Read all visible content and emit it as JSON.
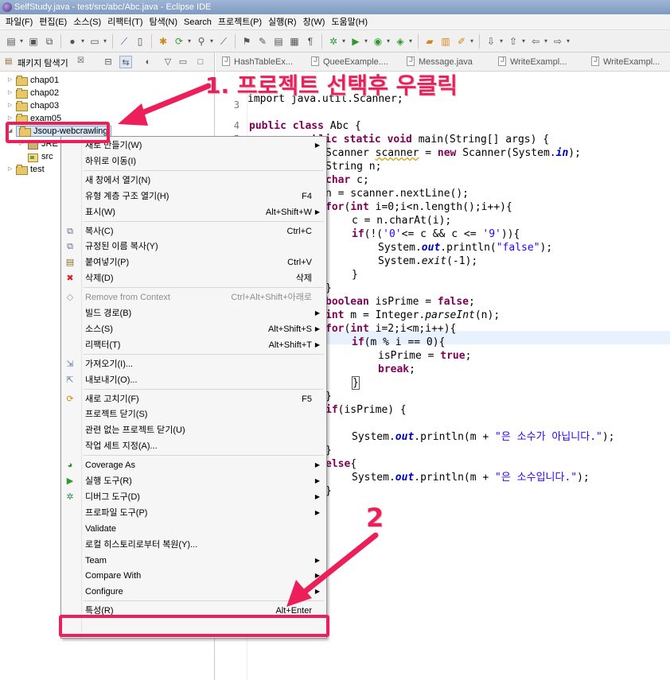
{
  "window": {
    "title": "SelfStudy.java - test/src/abc/Abc.java - Eclipse IDE"
  },
  "menubar": [
    "파일(F)",
    "편집(E)",
    "소스(S)",
    "리팩터(T)",
    "탐색(N)",
    "Search",
    "프로젝트(P)",
    "실행(R)",
    "창(W)",
    "도움말(H)"
  ],
  "package_explorer": {
    "title": "패키지 탐색기",
    "close": "☒",
    "items": [
      {
        "label": "chap01"
      },
      {
        "label": "chap02"
      },
      {
        "label": "chap03"
      },
      {
        "label": "exam05"
      },
      {
        "label": "Jsoup-webcrawling"
      },
      {
        "label": "JRE"
      },
      {
        "label": "src"
      },
      {
        "label": "test"
      }
    ]
  },
  "editor_tabs": [
    {
      "label": "HashTableEx..."
    },
    {
      "label": "QueeExample...."
    },
    {
      "label": "Message.java"
    },
    {
      "label": "WriteExampl..."
    },
    {
      "label": "WriteExampl..."
    }
  ],
  "code": {
    "line_numbers": [
      "3",
      "4",
      "5"
    ],
    "lines": [
      {
        "segments": [
          {
            "t": "import java.util.Scanner;",
            "c": ""
          }
        ]
      },
      {
        "segments": [
          {
            "t": "public class",
            "c": "kw"
          },
          {
            "t": " Abc {",
            "c": ""
          }
        ]
      },
      {
        "segments": [
          {
            "t": "public static void",
            "c": "kw"
          },
          {
            "t": " main(String[] args) {",
            "c": ""
          }
        ]
      },
      {
        "segments": [
          {
            "t": "Scanner ",
            "c": ""
          },
          {
            "t": "scanner",
            "c": "warn"
          },
          {
            "t": " = ",
            "c": ""
          },
          {
            "t": "new",
            "c": "kw"
          },
          {
            "t": " Scanner(System.",
            "c": ""
          },
          {
            "t": "in",
            "c": "fld"
          },
          {
            "t": ");",
            "c": ""
          }
        ]
      },
      {
        "segments": [
          {
            "t": "String n;",
            "c": ""
          }
        ]
      },
      {
        "segments": [
          {
            "t": "char",
            "c": "kw"
          },
          {
            "t": " c;",
            "c": ""
          }
        ]
      },
      {
        "segments": [
          {
            "t": "n = scanner.nextLine();",
            "c": ""
          }
        ]
      },
      {
        "segments": [
          {
            "t": "for",
            "c": "kw"
          },
          {
            "t": "(",
            "c": ""
          },
          {
            "t": "int",
            "c": "kw"
          },
          {
            "t": " i=0;i<n.length();i++){",
            "c": ""
          }
        ]
      },
      {
        "segments": [
          {
            "t": "c = n.charAt(i);",
            "c": ""
          }
        ]
      },
      {
        "segments": [
          {
            "t": "if",
            "c": "kw"
          },
          {
            "t": "(!(",
            "c": ""
          },
          {
            "t": "'0'",
            "c": "str"
          },
          {
            "t": "<= c && c <= ",
            "c": ""
          },
          {
            "t": "'9'",
            "c": "str"
          },
          {
            "t": ")){",
            "c": ""
          }
        ]
      },
      {
        "segments": [
          {
            "t": "System.",
            "c": ""
          },
          {
            "t": "out",
            "c": "fld"
          },
          {
            "t": ".println(",
            "c": ""
          },
          {
            "t": "\"false\"",
            "c": "str"
          },
          {
            "t": ");",
            "c": ""
          }
        ]
      },
      {
        "segments": [
          {
            "t": "System.",
            "c": ""
          },
          {
            "t": "exit",
            "c": "ital"
          },
          {
            "t": "(-1);",
            "c": ""
          }
        ]
      },
      {
        "segments": [
          {
            "t": "}",
            "c": ""
          }
        ]
      },
      {
        "segments": [
          {
            "t": "}",
            "c": ""
          }
        ]
      },
      {
        "segments": [
          {
            "t": "boolean",
            "c": "kw"
          },
          {
            "t": " isPrime = ",
            "c": ""
          },
          {
            "t": "false",
            "c": "kw"
          },
          {
            "t": ";",
            "c": ""
          }
        ]
      },
      {
        "segments": [
          {
            "t": "int",
            "c": "kw"
          },
          {
            "t": " m = Integer.",
            "c": ""
          },
          {
            "t": "parseInt",
            "c": "ital"
          },
          {
            "t": "(n);",
            "c": ""
          }
        ]
      },
      {
        "segments": [
          {
            "t": "for",
            "c": "kw"
          },
          {
            "t": "(",
            "c": ""
          },
          {
            "t": "int",
            "c": "kw"
          },
          {
            "t": " i=2;i<m;i++){",
            "c": ""
          }
        ]
      },
      {
        "segments": [
          {
            "t": "if",
            "c": "kw"
          },
          {
            "t": "(m % i == 0){",
            "c": ""
          }
        ]
      },
      {
        "segments": [
          {
            "t": "isPrime = ",
            "c": ""
          },
          {
            "t": "true",
            "c": "kw"
          },
          {
            "t": ";",
            "c": ""
          }
        ]
      },
      {
        "segments": [
          {
            "t": "break",
            "c": "kw"
          },
          {
            "t": ";",
            "c": ""
          }
        ]
      },
      {
        "segments": [
          {
            "t": "}",
            "c": "box"
          }
        ]
      },
      {
        "segments": [
          {
            "t": "}",
            "c": ""
          }
        ]
      },
      {
        "segments": [
          {
            "t": "if",
            "c": "kw"
          },
          {
            "t": "(isPrime) {",
            "c": ""
          }
        ]
      },
      {
        "segments": [
          {
            "t": "",
            "c": ""
          }
        ]
      },
      {
        "segments": [
          {
            "t": "System.",
            "c": ""
          },
          {
            "t": "out",
            "c": "fld"
          },
          {
            "t": ".println(m + ",
            "c": ""
          },
          {
            "t": "\"은 소수가 아닙니다.\"",
            "c": "str"
          },
          {
            "t": ");",
            "c": ""
          }
        ]
      },
      {
        "segments": [
          {
            "t": "}",
            "c": ""
          }
        ]
      },
      {
        "segments": [
          {
            "t": "else",
            "c": "kw"
          },
          {
            "t": "{",
            "c": ""
          }
        ]
      },
      {
        "segments": [
          {
            "t": "System.",
            "c": ""
          },
          {
            "t": "out",
            "c": "fld"
          },
          {
            "t": ".println(m + ",
            "c": ""
          },
          {
            "t": "\"은 소수입니다.\"",
            "c": "str"
          },
          {
            "t": ");",
            "c": ""
          }
        ]
      },
      {
        "segments": [
          {
            "t": "}",
            "c": ""
          }
        ]
      }
    ]
  },
  "context_menu": {
    "items": [
      {
        "label": "새로 만들기(W)",
        "shortcut": "",
        "submenu": true,
        "icon": "",
        "disabled": false
      },
      {
        "label": "하위로 이동(I)",
        "shortcut": "",
        "submenu": false,
        "icon": "",
        "disabled": false
      },
      {
        "sep": true
      },
      {
        "label": "새 창에서 열기(N)",
        "shortcut": "",
        "submenu": false,
        "icon": "",
        "disabled": false
      },
      {
        "label": "유형 계층 구조 열기(H)",
        "shortcut": "F4",
        "submenu": false,
        "icon": "",
        "disabled": false
      },
      {
        "label": "표시(W)",
        "shortcut": "Alt+Shift+W",
        "submenu": true,
        "icon": "",
        "disabled": false
      },
      {
        "sep": true
      },
      {
        "label": "복사(C)",
        "shortcut": "Ctrl+C",
        "submenu": false,
        "icon": "copy-icon",
        "disabled": false
      },
      {
        "label": "규정된 이름 복사(Y)",
        "shortcut": "",
        "submenu": false,
        "icon": "copy-qualified-icon",
        "disabled": false
      },
      {
        "label": "붙여넣기(P)",
        "shortcut": "Ctrl+V",
        "submenu": false,
        "icon": "paste-icon",
        "disabled": false
      },
      {
        "label": "삭제(D)",
        "shortcut": "삭제",
        "submenu": false,
        "icon": "delete-icon",
        "disabled": false
      },
      {
        "sep": true
      },
      {
        "label": "Remove from Context",
        "shortcut": "Ctrl+Alt+Shift+아래로",
        "submenu": false,
        "icon": "remove-context-icon",
        "disabled": true
      },
      {
        "label": "빌드 경로(B)",
        "shortcut": "",
        "submenu": true,
        "icon": "",
        "disabled": false
      },
      {
        "label": "소스(S)",
        "shortcut": "Alt+Shift+S",
        "submenu": true,
        "icon": "",
        "disabled": false
      },
      {
        "label": "리팩터(T)",
        "shortcut": "Alt+Shift+T",
        "submenu": true,
        "icon": "",
        "disabled": false
      },
      {
        "sep": true
      },
      {
        "label": "가져오기(I)...",
        "shortcut": "",
        "submenu": false,
        "icon": "import-icon",
        "disabled": false
      },
      {
        "label": "내보내기(O)...",
        "shortcut": "",
        "submenu": false,
        "icon": "export-icon",
        "disabled": false
      },
      {
        "sep": true
      },
      {
        "label": "새로 고치기(F)",
        "shortcut": "F5",
        "submenu": false,
        "icon": "refresh-icon",
        "disabled": false
      },
      {
        "label": "프로젝트 닫기(S)",
        "shortcut": "",
        "submenu": false,
        "icon": "",
        "disabled": false
      },
      {
        "label": "관련 없는 프로젝트 닫기(U)",
        "shortcut": "",
        "submenu": false,
        "icon": "",
        "disabled": false
      },
      {
        "label": "작업 세트 지정(A)...",
        "shortcut": "",
        "submenu": false,
        "icon": "",
        "disabled": false
      },
      {
        "sep": true
      },
      {
        "label": "Coverage As",
        "shortcut": "",
        "submenu": true,
        "icon": "coverage-icon",
        "disabled": false
      },
      {
        "label": "실행 도구(R)",
        "shortcut": "",
        "submenu": true,
        "icon": "run-icon",
        "disabled": false
      },
      {
        "label": "디버그 도구(D)",
        "shortcut": "",
        "submenu": true,
        "icon": "debug-icon",
        "disabled": false
      },
      {
        "label": "프로파일 도구(P)",
        "shortcut": "",
        "submenu": true,
        "icon": "",
        "disabled": false
      },
      {
        "label": "Validate",
        "shortcut": "",
        "submenu": false,
        "icon": "",
        "disabled": false
      },
      {
        "label": "로컬 히스토리로부터 복원(Y)...",
        "shortcut": "",
        "submenu": false,
        "icon": "",
        "disabled": false
      },
      {
        "label": "Team",
        "shortcut": "",
        "submenu": true,
        "icon": "",
        "disabled": false
      },
      {
        "label": "Compare With",
        "shortcut": "",
        "submenu": true,
        "icon": "",
        "disabled": false
      },
      {
        "label": "Configure",
        "shortcut": "",
        "submenu": true,
        "icon": "",
        "disabled": false
      },
      {
        "sep": true
      },
      {
        "label": "특성(R)",
        "shortcut": "Alt+Enter",
        "submenu": false,
        "icon": "",
        "disabled": false
      }
    ]
  },
  "annotations": {
    "step1": "1. 프로젝트 선택후 우클릭",
    "step2": "2",
    "accent_color": "#ec1f5a"
  }
}
